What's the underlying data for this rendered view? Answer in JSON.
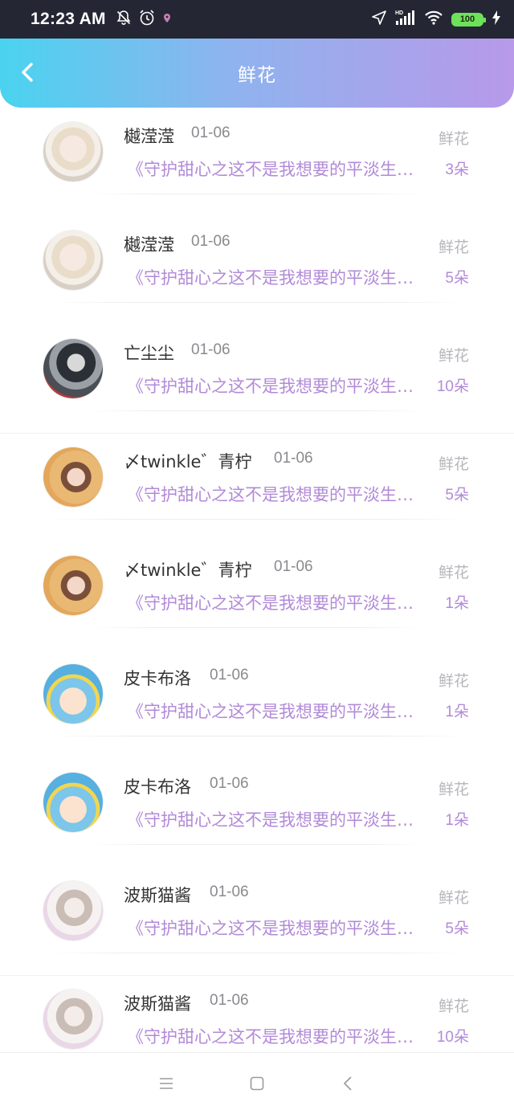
{
  "status_bar": {
    "time": "12:23 AM",
    "battery": "100",
    "network": "HD"
  },
  "header": {
    "title": "鲜花",
    "back_icon": "chevron-left-icon"
  },
  "colors": {
    "header_gradient": [
      "#4ad3ef",
      "#8fb3ee",
      "#b899ea"
    ],
    "accent_purple": "#b28ad8",
    "name_text": "#333333",
    "meta_text": "#8a8a8f",
    "battery_green": "#6ee15a"
  },
  "records": [
    {
      "name": "樾滢滢",
      "date": "01-06",
      "type": "鲜花",
      "book": "《守护甜心之这不是我想要的平淡生活》",
      "count": "3朵",
      "avatar": "avatar-portrait-light-hair"
    },
    {
      "name": "樾滢滢",
      "date": "01-06",
      "type": "鲜花",
      "book": "《守护甜心之这不是我想要的平淡生活》",
      "count": "5朵",
      "avatar": "avatar-portrait-light-hair"
    },
    {
      "name": "亡尘尘",
      "date": "01-06",
      "type": "鲜花",
      "book": "《守护甜心之这不是我想要的平淡生活》",
      "count": "10朵",
      "avatar": "avatar-ink-painting"
    },
    {
      "name": "〆twinkle゛青柠",
      "date": "01-06",
      "type": "鲜花",
      "book": "《守护甜心之这不是我想要的平淡生活》",
      "count": "5朵",
      "avatar": "avatar-warm-portrait"
    },
    {
      "name": "〆twinkle゛青柠",
      "date": "01-06",
      "type": "鲜花",
      "book": "《守护甜心之这不是我想要的平淡生活》",
      "count": "1朵",
      "avatar": "avatar-warm-portrait"
    },
    {
      "name": "皮卡布洛",
      "date": "01-06",
      "type": "鲜花",
      "book": "《守护甜心之这不是我想要的平淡生活》",
      "count": "1朵",
      "avatar": "avatar-cartoon-blue"
    },
    {
      "name": "皮卡布洛",
      "date": "01-06",
      "type": "鲜花",
      "book": "《守护甜心之这不是我想要的平淡生活》",
      "count": "1朵",
      "avatar": "avatar-cartoon-blue"
    },
    {
      "name": "波斯猫酱",
      "date": "01-06",
      "type": "鲜花",
      "book": "《守护甜心之这不是我想要的平淡生活》",
      "count": "5朵",
      "avatar": "avatar-anime-girl"
    },
    {
      "name": "波斯猫酱",
      "date": "01-06",
      "type": "鲜花",
      "book": "《守护甜心之这不是我想要的平淡生活》",
      "count": "10朵",
      "avatar": "avatar-anime-girl"
    }
  ],
  "nav_bar": {
    "menu_icon": "menu-icon",
    "home_icon": "home-square-icon",
    "back_icon": "back-triangle-icon"
  }
}
